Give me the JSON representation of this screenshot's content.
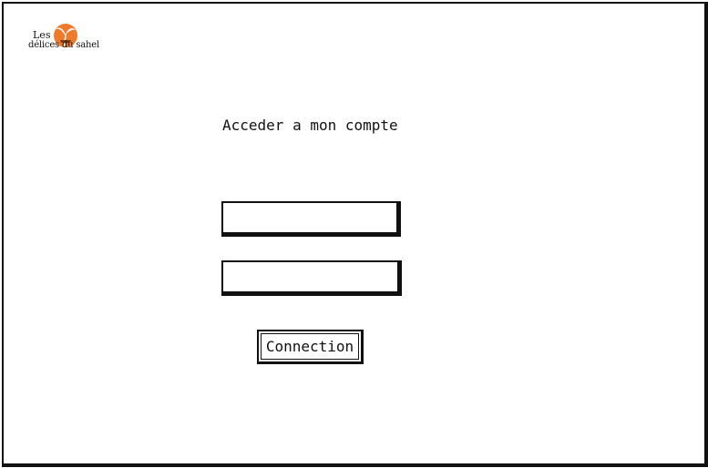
{
  "logo": {
    "line1": "Les",
    "line2": "délices du sahel",
    "icon": "sun-palm-icon",
    "accent_color": "#f07a2c"
  },
  "login": {
    "title": "Acceder a mon compte",
    "field1_value": "",
    "field2_value": "",
    "submit_label": "Connection"
  }
}
